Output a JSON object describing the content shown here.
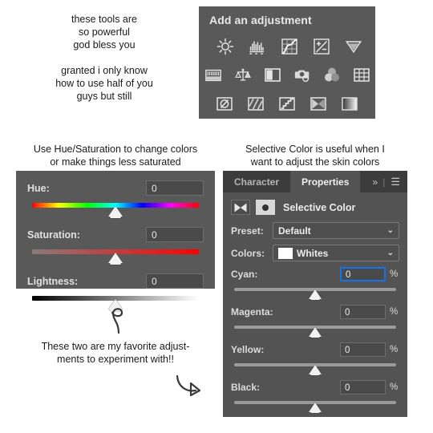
{
  "annotations": {
    "top_left_1": "these tools are\nso powerful\ngod bless you",
    "top_left_2": "granted i only know\nhow to use half of you\nguys but still",
    "hue_sat_caption": "Use Hue/Saturation to change colors\nor make things less saturated",
    "selective_color_caption": "Selective Color is useful when I\nwant to adjust the skin colors",
    "favorite_caption": "These two are my favorite adjust-\nments to experiment with!!"
  },
  "add_adjustment": {
    "title": "Add an adjustment",
    "rows": [
      [
        {
          "name": "brightness-contrast-icon",
          "label": "Brightness/Contrast"
        },
        {
          "name": "levels-icon",
          "label": "Levels"
        },
        {
          "name": "curves-icon",
          "label": "Curves"
        },
        {
          "name": "exposure-icon",
          "label": "Exposure"
        },
        {
          "name": "vibrance-icon",
          "label": "Vibrance"
        }
      ],
      [
        {
          "name": "hue-saturation-icon",
          "label": "Hue/Saturation"
        },
        {
          "name": "color-balance-icon",
          "label": "Color Balance"
        },
        {
          "name": "black-white-icon",
          "label": "Black & White"
        },
        {
          "name": "photo-filter-icon",
          "label": "Photo Filter"
        },
        {
          "name": "channel-mixer-icon",
          "label": "Channel Mixer"
        },
        {
          "name": "color-lookup-icon",
          "label": "Color Lookup"
        }
      ],
      [
        {
          "name": "invert-icon",
          "label": "Invert"
        },
        {
          "name": "posterize-icon",
          "label": "Posterize"
        },
        {
          "name": "threshold-icon",
          "label": "Threshold"
        },
        {
          "name": "selective-color-icon",
          "label": "Selective Color"
        },
        {
          "name": "gradient-map-icon",
          "label": "Gradient Map"
        }
      ]
    ]
  },
  "hue_saturation": {
    "sliders": [
      {
        "label": "Hue:",
        "value": "0",
        "thumb_pct": 50
      },
      {
        "label": "Saturation:",
        "value": "0",
        "thumb_pct": 50
      },
      {
        "label": "Lightness:",
        "value": "0",
        "thumb_pct": 50
      }
    ]
  },
  "properties": {
    "tabs": [
      {
        "label": "Character",
        "active": false
      },
      {
        "label": "Properties",
        "active": true
      }
    ],
    "expand_icon": "»",
    "divider": "|",
    "menu_icon": "☰",
    "adjustment_title": "Selective Color",
    "preset": {
      "label": "Preset:",
      "value": "Default",
      "caret": "⌄"
    },
    "colors": {
      "label": "Colors:",
      "value": "Whites",
      "swatch": "#ffffff",
      "caret": "⌄"
    },
    "sliders": [
      {
        "label": "Cyan:",
        "value": "0",
        "unit": "%",
        "thumb_pct": 50,
        "focused": true
      },
      {
        "label": "Magenta:",
        "value": "0",
        "unit": "%",
        "thumb_pct": 50,
        "focused": false
      },
      {
        "label": "Yellow:",
        "value": "0",
        "unit": "%",
        "thumb_pct": 50,
        "focused": false
      },
      {
        "label": "Black:",
        "value": "0",
        "unit": "%",
        "thumb_pct": 50,
        "focused": false
      }
    ]
  },
  "colors": {
    "panel_bg": "#595959",
    "properties_bg": "#535353",
    "tab_inactive_bg": "#3c3c3c",
    "focus_blue": "#1473e6",
    "page_bg": "#ffffff"
  }
}
